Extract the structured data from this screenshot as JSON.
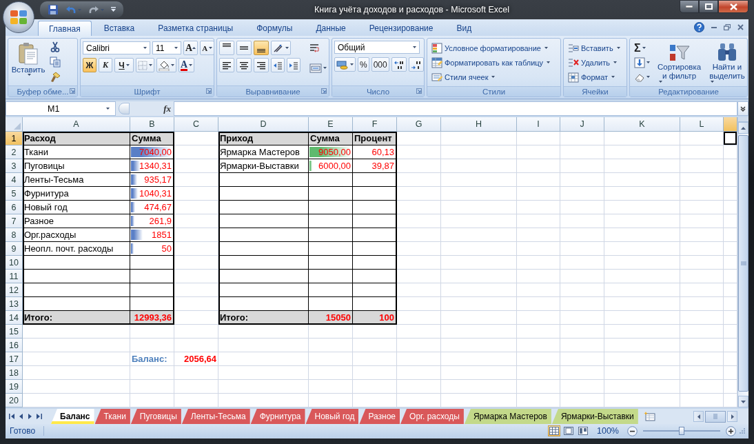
{
  "window": {
    "title": "Книга учёта доходов и расходов - Microsoft Excel"
  },
  "tabs": [
    {
      "label": "Главная",
      "selected": true
    },
    {
      "label": "Вставка",
      "selected": false
    },
    {
      "label": "Разметка страницы",
      "selected": false
    },
    {
      "label": "Формулы",
      "selected": false
    },
    {
      "label": "Данные",
      "selected": false
    },
    {
      "label": "Рецензирование",
      "selected": false
    },
    {
      "label": "Вид",
      "selected": false
    }
  ],
  "ribbon": {
    "groups": [
      {
        "kind": "clipboard",
        "label": "Буфер обме...",
        "paste_label": "Вставить"
      },
      {
        "kind": "font",
        "label": "Шрифт",
        "font_name": "Calibri",
        "font_size": "11",
        "size_buttons": [
          "A",
          "A"
        ],
        "color_button_label": "A",
        "styles": [
          {
            "label": "Ж",
            "selected": true
          },
          {
            "label": "К",
            "selected": false
          },
          {
            "label": "Ч",
            "selected": false
          }
        ]
      },
      {
        "kind": "alignment",
        "label": "Выравнивание",
        "vertical": [
          {
            "selected": false
          },
          {
            "selected": false
          },
          {
            "selected": true
          }
        ]
      },
      {
        "kind": "number",
        "label": "Число",
        "format": "Общий",
        "buttons": [
          "%",
          "000"
        ]
      },
      {
        "kind": "styles",
        "label": "Стили",
        "commands": [
          "Условное форматирование",
          "Форматировать как таблицу",
          "Стили ячеек"
        ]
      },
      {
        "kind": "cells",
        "label": "Ячейки",
        "commands": [
          "Вставить",
          "Удалить",
          "Формат"
        ]
      },
      {
        "kind": "editing",
        "label": "Редактирование",
        "sum_label": "Σ",
        "commands": [
          "Сортировка и фильтр",
          "Найти и выделить"
        ]
      }
    ]
  },
  "formula_bar": {
    "name_box": "M1",
    "function_label": "fx"
  },
  "sheet": {
    "columns": [
      {
        "label": "A",
        "selected": false
      },
      {
        "label": "B",
        "selected": false
      },
      {
        "label": "C",
        "selected": false
      },
      {
        "label": "D",
        "selected": false
      },
      {
        "label": "E",
        "selected": false
      },
      {
        "label": "F",
        "selected": false
      },
      {
        "label": "G",
        "selected": false
      },
      {
        "label": "H",
        "selected": false
      },
      {
        "label": "I",
        "selected": false
      },
      {
        "label": "J",
        "selected": false
      },
      {
        "label": "K",
        "selected": false
      },
      {
        "label": "L",
        "selected": false
      },
      {
        "selected": true
      }
    ],
    "rows": [
      {
        "label": "1",
        "selected": true
      },
      {
        "label": "2",
        "selected": false
      },
      {
        "label": "3",
        "selected": false
      },
      {
        "label": "4",
        "selected": false
      },
      {
        "label": "5",
        "selected": false
      },
      {
        "label": "6",
        "selected": false
      },
      {
        "label": "7",
        "selected": false
      },
      {
        "label": "8",
        "selected": false
      },
      {
        "label": "9",
        "selected": false
      },
      {
        "label": "10",
        "selected": false
      },
      {
        "label": "11",
        "selected": false
      },
      {
        "label": "12",
        "selected": false
      },
      {
        "label": "13",
        "selected": false
      },
      {
        "label": "14",
        "selected": false
      },
      {
        "label": "15",
        "selected": false
      },
      {
        "label": "16",
        "selected": false
      },
      {
        "label": "17",
        "selected": false
      },
      {
        "label": "18",
        "selected": false
      },
      {
        "label": "19",
        "selected": false
      },
      {
        "label": "20",
        "selected": false
      }
    ],
    "expense_table": {
      "headers": [
        "Расход",
        "Сумма"
      ],
      "rows": [
        {
          "name": "Ткани",
          "amount": "7040,00",
          "data_bar": {
            "level": 1.0,
            "color": "#5a7fc6"
          }
        },
        {
          "name": "Пуговицы",
          "amount": "1340,31",
          "data_bar": {
            "level": 0.22,
            "color": "#5a7fc6"
          }
        },
        {
          "name": "Ленты-Тесьма",
          "amount": "935,17",
          "data_bar": {
            "level": 0.15,
            "color": "#5a7fc6"
          }
        },
        {
          "name": "Фурнитура",
          "amount": "1040,31",
          "data_bar": {
            "level": 0.17,
            "color": "#5a7fc6"
          }
        },
        {
          "name": "Новый год",
          "amount": "474,67",
          "data_bar": {
            "level": 0.1,
            "color": "#5a7fc6"
          }
        },
        {
          "name": "Разное",
          "amount": "261,9",
          "data_bar": {
            "level": 0.08,
            "color": "#5a7fc6"
          }
        },
        {
          "name": "Орг.расходы",
          "amount": "1851",
          "data_bar": {
            "level": 0.28,
            "color": "#5a7fc6"
          }
        },
        {
          "name": "Неопл. почт. расходы",
          "amount": "50",
          "data_bar": {
            "level": 0.06,
            "color": "#5a7fc6"
          }
        }
      ],
      "total_label": "Итого:",
      "total": "12993,36"
    },
    "income_table": {
      "headers": [
        "Приход",
        "Сумма",
        "Процент"
      ],
      "rows": [
        {
          "name": "Ярмарка Мастеров",
          "amount": "9050,00",
          "percent": "60,13",
          "data_bar": {
            "level": 1.0,
            "color": "#5fba6e"
          }
        },
        {
          "name": "Ярмарки-Выставки",
          "amount": "6000,00",
          "percent": "39,87",
          "data_bar": {
            "level": 0.06,
            "color": "#5fba6e"
          }
        }
      ],
      "total_label": "Итого:",
      "total": "15050",
      "total_percent": "100"
    },
    "balance": {
      "label": "Баланс:",
      "value": "2056,64"
    }
  },
  "sheet_tabs": [
    {
      "label": "Баланс",
      "selected": true,
      "color": "#ffe94a"
    },
    {
      "label": "Ткани",
      "selected": false,
      "color": "#d9585a"
    },
    {
      "label": "Пуговицы",
      "selected": false,
      "color": "#d9585a"
    },
    {
      "label": "Ленты-Тесьма",
      "selected": false,
      "color": "#d9585a"
    },
    {
      "label": "Фурнитура",
      "selected": false,
      "color": "#d9585a"
    },
    {
      "label": "Новый год",
      "selected": false,
      "color": "#d9585a"
    },
    {
      "label": "Разное",
      "selected": false,
      "color": "#d9585a"
    },
    {
      "label": "Орг. расходы",
      "selected": false,
      "color": "#d9585a"
    },
    {
      "label": "Ярмарка Мастеров",
      "selected": false,
      "color": "#c3d98a"
    },
    {
      "label": "Ярмарки-Выставки",
      "selected": false,
      "color": "#c3d98a"
    }
  ],
  "status_bar": {
    "status": "Готово",
    "views": [
      {
        "selected": true
      },
      {
        "selected": false
      },
      {
        "selected": false
      }
    ],
    "zoom": "100%",
    "zoom_slider": {
      "level": 0.5
    }
  }
}
